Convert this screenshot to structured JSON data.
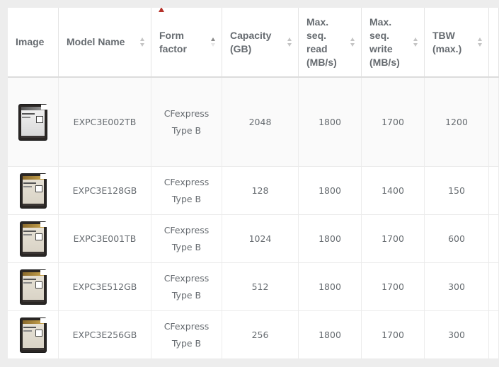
{
  "columns": [
    {
      "key": "image",
      "label": "Image",
      "sortable": false
    },
    {
      "key": "model",
      "label": "Model Name",
      "sortable": true
    },
    {
      "key": "form",
      "label": "Form factor",
      "sortable": true
    },
    {
      "key": "capacity",
      "label": "Capacity (GB)",
      "sortable": true
    },
    {
      "key": "read",
      "label": "Max. seq. read (MB/s)",
      "sortable": true
    },
    {
      "key": "write",
      "label": "Max. seq. write (MB/s)",
      "sortable": true
    },
    {
      "key": "tbw",
      "label": "TBW (max.)",
      "sortable": true
    }
  ],
  "sort": {
    "column": "form",
    "direction": "ascending",
    "marker_color": "#b5322a"
  },
  "rows": [
    {
      "image_icon": "cfexpress-card-silver-icon",
      "model": "EXPC3E002TB",
      "form_line1": "CFexpress",
      "form_line2": "Type B",
      "capacity": "2048",
      "read": "1800",
      "write": "1700",
      "tbw": "1200"
    },
    {
      "image_icon": "cfexpress-card-gold-icon",
      "model": "EXPC3E128GB",
      "form_line1": "CFexpress",
      "form_line2": "Type B",
      "capacity": "128",
      "read": "1800",
      "write": "1400",
      "tbw": "150"
    },
    {
      "image_icon": "cfexpress-card-gold-icon",
      "model": "EXPC3E001TB",
      "form_line1": "CFexpress",
      "form_line2": "Type B",
      "capacity": "1024",
      "read": "1800",
      "write": "1700",
      "tbw": "600"
    },
    {
      "image_icon": "cfexpress-card-gold-icon",
      "model": "EXPC3E512GB",
      "form_line1": "CFexpress",
      "form_line2": "Type B",
      "capacity": "512",
      "read": "1800",
      "write": "1700",
      "tbw": "300"
    },
    {
      "image_icon": "cfexpress-card-gold-icon",
      "model": "EXPC3E256GB",
      "form_line1": "CFexpress",
      "form_line2": "Type B",
      "capacity": "256",
      "read": "1800",
      "write": "1700",
      "tbw": "300"
    }
  ]
}
